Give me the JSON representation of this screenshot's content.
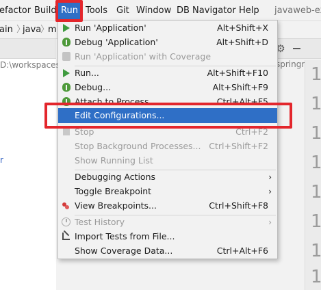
{
  "menubar": {
    "items": [
      {
        "label": "efactor"
      },
      {
        "label": "Build"
      },
      {
        "label": "Run"
      },
      {
        "label": "Tools"
      },
      {
        "label": "Git"
      },
      {
        "label": "Window"
      },
      {
        "label": "DB Navigator"
      },
      {
        "label": "Help"
      },
      {
        "label": "javaweb-ex"
      }
    ]
  },
  "breadcrumb": {
    "items": [
      "ain",
      "java",
      "m"
    ]
  },
  "project_panel": {
    "path_text": "D:\\workspaces",
    "blue_text": "r"
  },
  "editor": {
    "partial_text": "springm",
    "gutter_lines": [
      "1",
      "1",
      "1",
      "1",
      "1",
      "1",
      "1",
      "1",
      "1",
      "1",
      "1"
    ]
  },
  "run_menu": {
    "items": [
      {
        "label": "Run 'Application'",
        "shortcut": "Alt+Shift+X",
        "icon": "run-icon",
        "enabled": true
      },
      {
        "label": "Debug 'Application'",
        "shortcut": "Alt+Shift+D",
        "icon": "debug-icon",
        "enabled": true
      },
      {
        "label": "Run 'Application' with Coverage",
        "shortcut": "",
        "icon": "coverage-icon",
        "enabled": false
      },
      {
        "label": "Run...",
        "shortcut": "Alt+Shift+F10",
        "icon": "run-icon",
        "enabled": true
      },
      {
        "label": "Debug...",
        "shortcut": "Alt+Shift+F9",
        "icon": "debug-icon",
        "enabled": true
      },
      {
        "label": "Attach to Process...",
        "shortcut": "Ctrl+Alt+F5",
        "icon": "debug-icon",
        "enabled": true
      },
      {
        "label": "Edit Configurations...",
        "shortcut": "",
        "icon": "",
        "enabled": true,
        "selected": true
      },
      {
        "label": "Stop",
        "shortcut": "Ctrl+F2",
        "icon": "stop-icon",
        "enabled": false
      },
      {
        "label": "Stop Background Processes...",
        "shortcut": "Ctrl+Shift+F2",
        "icon": "",
        "enabled": false
      },
      {
        "label": "Show Running List",
        "shortcut": "",
        "icon": "",
        "enabled": false
      },
      {
        "label": "Debugging Actions",
        "shortcut": "",
        "icon": "",
        "enabled": true,
        "submenu": true
      },
      {
        "label": "Toggle Breakpoint",
        "shortcut": "",
        "icon": "",
        "enabled": true,
        "submenu": true
      },
      {
        "label": "View Breakpoints...",
        "shortcut": "Ctrl+Shift+F8",
        "icon": "breakpoints-icon",
        "enabled": true
      },
      {
        "label": "Test History",
        "shortcut": "",
        "icon": "clock-icon",
        "enabled": false,
        "submenu": true
      },
      {
        "label": "Import Tests from File...",
        "shortcut": "",
        "icon": "import-icon",
        "enabled": true
      },
      {
        "label": "Show Coverage Data...",
        "shortcut": "Ctrl+Alt+F6",
        "icon": "",
        "enabled": true
      }
    ],
    "submenu_arrow": "›"
  },
  "colors": {
    "selection": "#2f6fc6",
    "highlight_box": "#e3262c",
    "run_green": "#3f9b3f"
  }
}
